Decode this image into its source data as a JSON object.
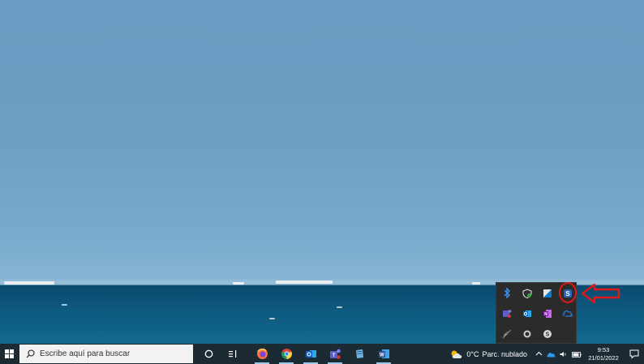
{
  "taskbar": {
    "search_placeholder": "Escribe aquí para buscar",
    "pinned_apps": [
      {
        "name": "firefox-icon",
        "color": "#ff7139"
      },
      {
        "name": "chrome-icon",
        "color": "#4285f4"
      },
      {
        "name": "outlook-icon",
        "color": "#0a64c8"
      },
      {
        "name": "teams-icon",
        "color": "#5b5fc7"
      },
      {
        "name": "notepad-icon",
        "color": "#6fb3e0"
      },
      {
        "name": "word-icon",
        "color": "#2b579a"
      }
    ],
    "weather": {
      "temperature": "0°C",
      "condition": "Parc. nublado"
    },
    "clock": {
      "time": "9:53",
      "date": "21/01/2022"
    }
  },
  "tray_flyout": {
    "icons": [
      {
        "name": "bluetooth-icon",
        "color": "#1e7be0"
      },
      {
        "name": "security-shield-icon",
        "color": "#3ca33c"
      },
      {
        "name": "remote-desktop-icon",
        "color": "#0b7ad1"
      },
      {
        "name": "skype-business-icon",
        "color": "#ffffff",
        "highlighted": true
      },
      {
        "name": "teams-tray-icon",
        "color": "#5b5fc7"
      },
      {
        "name": "outlook-tray-icon",
        "color": "#0a64c8"
      },
      {
        "name": "onenote-tray-icon",
        "color": "#7719aa"
      },
      {
        "name": "onedrive-tray-icon",
        "color": "#2b7bd6"
      },
      {
        "name": "wifi-icon",
        "color": "#bbbbbb"
      },
      {
        "name": "sync-icon",
        "color": "#bbbbbb"
      },
      {
        "name": "skype-icon",
        "color": "#bbbbbb"
      }
    ]
  },
  "annotation": {
    "highlight_color": "#e01818"
  }
}
